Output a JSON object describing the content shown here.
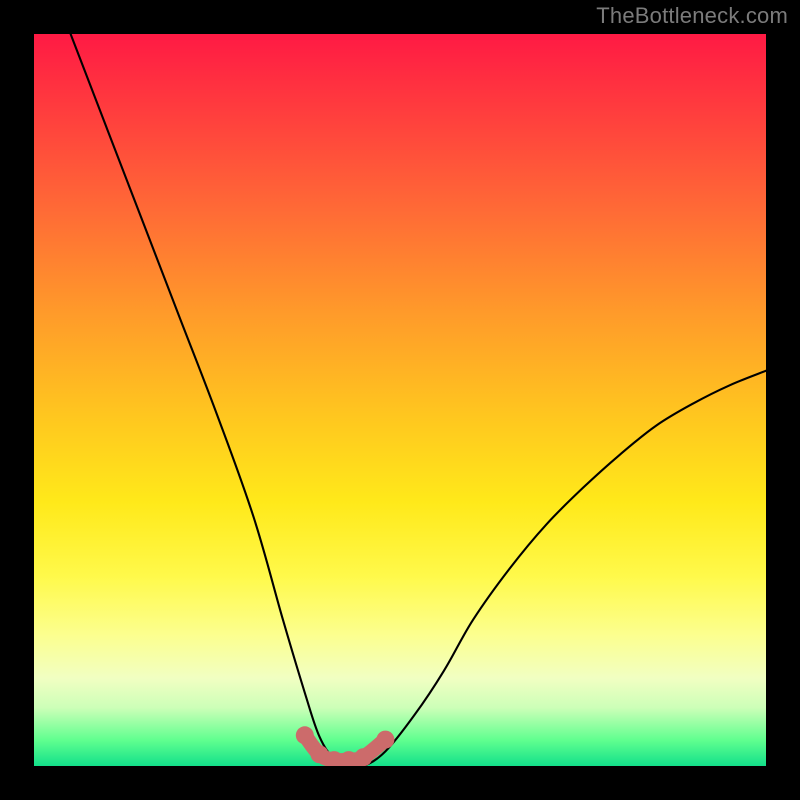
{
  "watermark": "TheBottleneck.com",
  "chart_data": {
    "type": "line",
    "title": "",
    "xlabel": "",
    "ylabel": "",
    "xlim": [
      0,
      100
    ],
    "ylim": [
      0,
      100
    ],
    "grid": false,
    "series": [
      {
        "name": "bottleneck-curve",
        "color": "#000000",
        "x": [
          5,
          10,
          15,
          20,
          25,
          30,
          34,
          37,
          39,
          41,
          43,
          45,
          48,
          52,
          56,
          60,
          65,
          70,
          75,
          80,
          85,
          90,
          95,
          100
        ],
        "values": [
          100,
          87,
          74,
          61,
          48,
          34,
          20,
          10,
          4,
          1,
          0,
          0,
          2,
          7,
          13,
          20,
          27,
          33,
          38,
          42.5,
          46.5,
          49.5,
          52,
          54
        ]
      },
      {
        "name": "bottom-highlight",
        "color": "#cc6b6b",
        "x": [
          37,
          39,
          41,
          43,
          45,
          48
        ],
        "values": [
          4.2,
          1.6,
          0.8,
          0.8,
          1.2,
          3.6
        ]
      }
    ],
    "gradient_stops": [
      {
        "pos": 0,
        "color": "#ff1a44"
      },
      {
        "pos": 0.1,
        "color": "#ff3b3e"
      },
      {
        "pos": 0.24,
        "color": "#ff6a36"
      },
      {
        "pos": 0.38,
        "color": "#ff9a2a"
      },
      {
        "pos": 0.52,
        "color": "#ffc61f"
      },
      {
        "pos": 0.64,
        "color": "#ffe91a"
      },
      {
        "pos": 0.74,
        "color": "#fff94a"
      },
      {
        "pos": 0.82,
        "color": "#fcff8e"
      },
      {
        "pos": 0.88,
        "color": "#f1ffc2"
      },
      {
        "pos": 0.92,
        "color": "#cdffb8"
      },
      {
        "pos": 0.965,
        "color": "#5fff8f"
      },
      {
        "pos": 1.0,
        "color": "#12e08a"
      }
    ]
  }
}
